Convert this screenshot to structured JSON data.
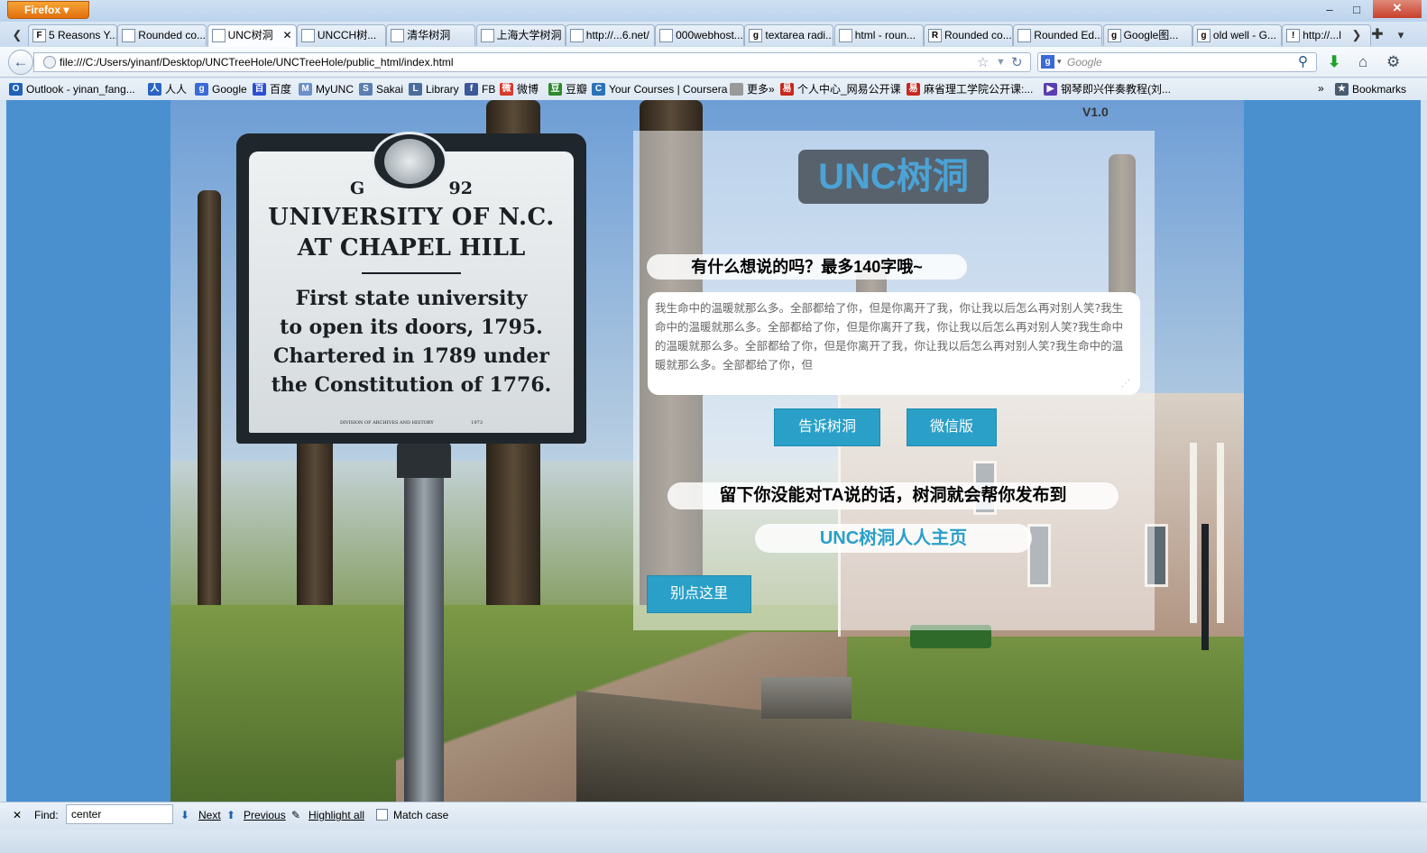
{
  "browser": {
    "menu_button": "Firefox",
    "window_controls": {
      "minimize": "–",
      "maximize": "□",
      "close": "✕"
    },
    "tabs": [
      {
        "label": "5 Reasons Y...",
        "icon": "F"
      },
      {
        "label": "Rounded co...",
        "icon": ""
      },
      {
        "label": "UNC树洞",
        "icon": "",
        "active": true
      },
      {
        "label": "UNCCH树...",
        "icon": ""
      },
      {
        "label": "清华树洞",
        "icon": ""
      },
      {
        "label": "上海大学树洞",
        "icon": ""
      },
      {
        "label": "http://...6.net/",
        "icon": ""
      },
      {
        "label": "000webhost...",
        "icon": ""
      },
      {
        "label": "textarea radi...",
        "icon": "g"
      },
      {
        "label": "html - roun...",
        "icon": ""
      },
      {
        "label": "Rounded co...",
        "icon": "R"
      },
      {
        "label": "Rounded Ed...",
        "icon": ""
      },
      {
        "label": "Google图...",
        "icon": "g"
      },
      {
        "label": "old well - G...",
        "icon": "g"
      },
      {
        "label": "http://...l",
        "icon": "!"
      }
    ],
    "url": "file:///C:/Users/yinanf/Desktop/UNCTreeHole/UNCTreeHole/public_html/index.html",
    "search_placeholder": "Google",
    "bookmarks": [
      {
        "label": "Outlook - yinan_fang...",
        "icon": "O",
        "color": "#1f62b8"
      },
      {
        "label": "人人",
        "icon": "人",
        "color": "#2b64c0"
      },
      {
        "label": "Google",
        "icon": "g",
        "color": "#3b6ad8"
      },
      {
        "label": "百度",
        "icon": "百",
        "color": "#2c4fd0"
      },
      {
        "label": "MyUNC",
        "icon": "M",
        "color": "#6b8fc7"
      },
      {
        "label": "Sakai",
        "icon": "S",
        "color": "#5a7fb0"
      },
      {
        "label": "Library",
        "icon": "L",
        "color": "#4a6d9c"
      },
      {
        "label": "FB",
        "icon": "f",
        "color": "#3b5998"
      },
      {
        "label": "微博",
        "icon": "微",
        "color": "#d93a2a"
      },
      {
        "label": "豆瓣",
        "icon": "豆",
        "color": "#2f8a2f"
      },
      {
        "label": "Your Courses | Coursera",
        "icon": "C",
        "color": "#2a73b8"
      },
      {
        "label": "更多»",
        "icon": "",
        "color": "#999999"
      },
      {
        "label": "个人中心_网易公开课",
        "icon": "易",
        "color": "#c8281e"
      },
      {
        "label": "麻省理工学院公开课:...",
        "icon": "易",
        "color": "#c8281e"
      },
      {
        "label": "钢琴即兴伴奏教程(刘...",
        "icon": "▶",
        "color": "#5a3db0"
      }
    ],
    "bookmarks_overflow": "»",
    "bookmarks_menu": "Bookmarks"
  },
  "page": {
    "version": "V1.0",
    "logo": "UNC树洞",
    "prompt": "有什么想说的吗？最多140字哦~",
    "message": "我生命中的温暖就那么多。全部都给了你，但是你离开了我，你让我以后怎么再对别人笑?我生命中的温暖就那么多。全部都给了你，但是你离开了我，你让我以后怎么再对别人笑?我生命中的温暖就那么多。全部都给了你，但是你离开了我，你让我以后怎么再对别人笑?我生命中的温暖就那么多。全部都给了你，但",
    "submit_button": "告诉树洞",
    "wechat_button": "微信版",
    "info": "留下你没能对TA说的话，树洞就会帮你发布到",
    "renren_link": "UNC树洞人人主页",
    "nope_button": "别点这里"
  },
  "sign": {
    "code_left": "G",
    "code_right": "92",
    "line1": "UNIVERSITY OF N.C.",
    "line2": "AT CHAPEL HILL",
    "body1": "First state university",
    "body2": "to open its doors, 1795.",
    "body3": "Chartered in 1789 under",
    "body4": "the Constitution of 1776.",
    "footer": "DIVISION OF ARCHIVES AND HISTORY",
    "footer_year": "1973"
  },
  "findbar": {
    "label": "Find:",
    "value": "center",
    "next": "Next",
    "previous": "Previous",
    "highlight_all": "Highlight all",
    "match_case": "Match case"
  }
}
